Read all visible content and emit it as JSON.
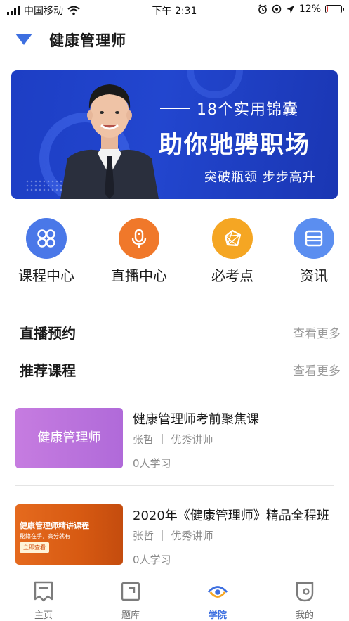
{
  "status_bar": {
    "carrier": "中国移动",
    "time": "下午 2:31",
    "battery_text": "12%",
    "battery_level": 0.12,
    "icons": [
      "signal-icon",
      "wifi-icon",
      "alarm-icon",
      "location-icon",
      "navigation-icon",
      "battery-icon"
    ]
  },
  "header": {
    "title": "健康管理师",
    "dropdown_icon": "triangle-down-icon"
  },
  "banner": {
    "line1": "18个实用锦囊",
    "line2": "助你驰骋职场",
    "line3": "突破瓶颈 步步高升"
  },
  "quick_nav": [
    {
      "label": "课程中心",
      "icon": "grid-icon",
      "color": "#4a78e8"
    },
    {
      "label": "直播中心",
      "icon": "microphone-icon",
      "color": "#f0782a"
    },
    {
      "label": "必考点",
      "icon": "target-network-icon",
      "color": "#f5a623"
    },
    {
      "label": "资讯",
      "icon": "news-icon",
      "color": "#5b8ef0"
    }
  ],
  "sections": {
    "live": {
      "title": "直播预约",
      "more": "查看更多"
    },
    "recommended": {
      "title": "推荐课程",
      "more": "查看更多"
    }
  },
  "courses": [
    {
      "title": "健康管理师考前聚焦课",
      "teacher": "张哲 ｜ 优秀讲师",
      "learners": "0人学习",
      "thumb_text": "健康管理师"
    },
    {
      "title": "2020年《健康管理师》精品全程班",
      "teacher": "张哲 ｜ 优秀讲师",
      "learners": "0人学习",
      "thumb_text": "健康管理师精讲课程",
      "thumb_sub": "秘籍在手，高分就有",
      "thumb_button": "立即查看"
    }
  ],
  "tabs": [
    {
      "label": "主页",
      "icon": "home-icon",
      "active": false
    },
    {
      "label": "题库",
      "icon": "question-bank-icon",
      "active": false
    },
    {
      "label": "学院",
      "icon": "academy-eye-icon",
      "active": true
    },
    {
      "label": "我的",
      "icon": "profile-icon",
      "active": false
    }
  ],
  "colors": {
    "accent": "#3d6fe0",
    "banner_bg": "#2246cf",
    "muted_text": "#9a9a9a"
  }
}
